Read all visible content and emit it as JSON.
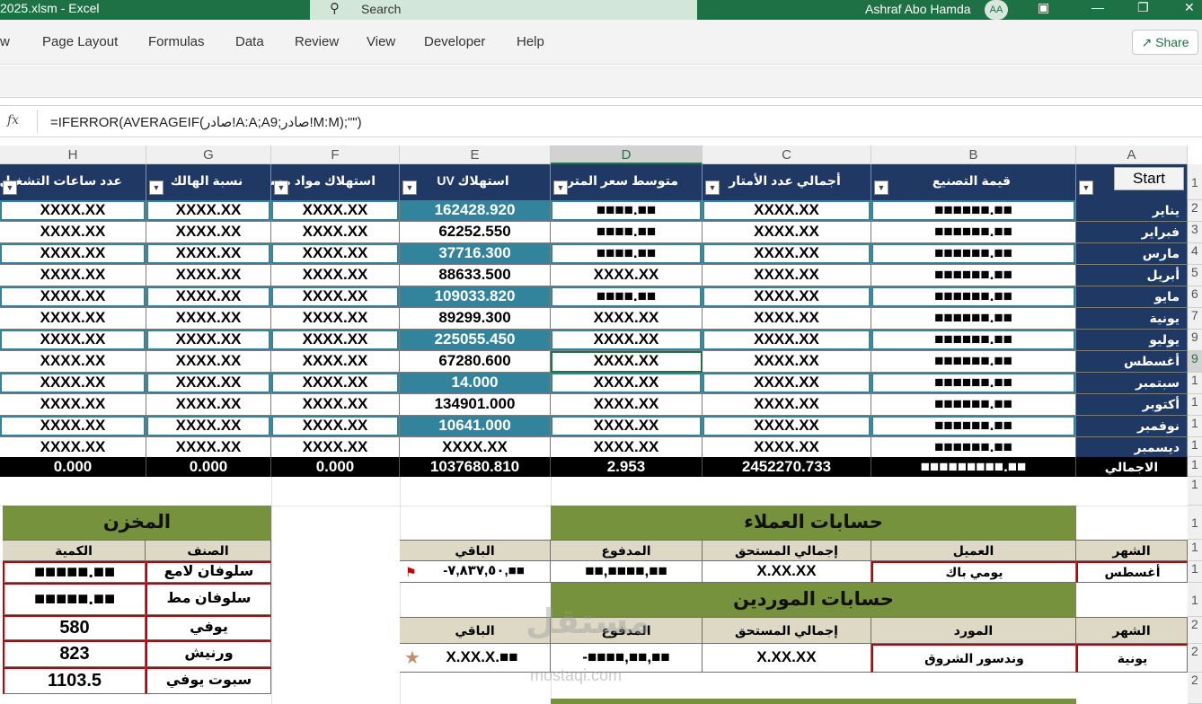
{
  "titlebar": {
    "file_title": "2025.xlsm  -  Excel",
    "search_placeholder": "Search",
    "user_name": "Ashraf Abo Hamda",
    "user_initials": "AA"
  },
  "menu": {
    "items": [
      "w",
      "Page Layout",
      "Formulas",
      "Data",
      "Review",
      "View",
      "Developer",
      "Help"
    ],
    "share_label": "Share"
  },
  "formula_bar": {
    "fx_label": "fx",
    "formula": "=IFERROR(AVERAGEIF(صادر!A:A;A9;صادر!M:M);\"\")"
  },
  "columns": [
    "H",
    "G",
    "F",
    "E",
    "D",
    "C",
    "B",
    "A"
  ],
  "row_numbers": [
    "1",
    "2",
    "3",
    "4",
    "5",
    "6",
    "7",
    "9",
    "9",
    "1",
    "1",
    "1",
    "1",
    "1",
    "1",
    "1",
    "1",
    "1",
    "1",
    "2",
    "2",
    "2"
  ],
  "main_table": {
    "headers": {
      "H": "عدد ساعات التشغيل",
      "G": "نسبة الهالك",
      "F": "استهلاك مواد مساعدة",
      "E": "استهلاك UV",
      "D": "متوسط سعر المتر",
      "C": "أجمالي عدد الأمتار",
      "B": "قيمة التصنيع"
    },
    "start_button": "Start",
    "rows": [
      {
        "month": "يناير",
        "B": "■■■■■■.■■",
        "C": "XXXX.XX",
        "D": "■■■■.■■",
        "E": "162428.920",
        "F": "XXXX.XX",
        "G": "XXXX.XX",
        "H": "XXXX.XX"
      },
      {
        "month": "فبراير",
        "B": "■■■■■■.■■",
        "C": "XXXX.XX",
        "D": "■■■■.■■",
        "E": "62252.550",
        "F": "XXXX.XX",
        "G": "XXXX.XX",
        "H": "XXXX.XX"
      },
      {
        "month": "مارس",
        "B": "■■■■■■.■■",
        "C": "XXXX.XX",
        "D": "■■■■.■■",
        "E": "37716.300",
        "F": "XXXX.XX",
        "G": "XXXX.XX",
        "H": "XXXX.XX"
      },
      {
        "month": "أبريل",
        "B": "■■■■■■.■■",
        "C": "XXXX.XX",
        "D": "XXXX.XX",
        "E": "88633.500",
        "F": "XXXX.XX",
        "G": "XXXX.XX",
        "H": "XXXX.XX"
      },
      {
        "month": "مايو",
        "B": "■■■■■■.■■",
        "C": "XXXX.XX",
        "D": "■■■■.■■",
        "E": "109033.820",
        "F": "XXXX.XX",
        "G": "XXXX.XX",
        "H": "XXXX.XX"
      },
      {
        "month": "يونية",
        "B": "■■■■■■.■■",
        "C": "XXXX.XX",
        "D": "XXXX.XX",
        "E": "89299.300",
        "F": "XXXX.XX",
        "G": "XXXX.XX",
        "H": "XXXX.XX"
      },
      {
        "month": "يوليو",
        "B": "■■■■■■.■■",
        "C": "XXXX.XX",
        "D": "XXXX.XX",
        "E": "225055.450",
        "F": "XXXX.XX",
        "G": "XXXX.XX",
        "H": "XXXX.XX"
      },
      {
        "month": "أغسطس",
        "B": "■■■■■■.■■",
        "C": "XXXX.XX",
        "D": "XXXX.XX",
        "E": "67280.600",
        "F": "XXXX.XX",
        "G": "XXXX.XX",
        "H": "XXXX.XX"
      },
      {
        "month": "سبتمبر",
        "B": "■■■■■■.■■",
        "C": "XXXX.XX",
        "D": "XXXX.XX",
        "E": "14.000",
        "F": "XXXX.XX",
        "G": "XXXX.XX",
        "H": "XXXX.XX"
      },
      {
        "month": "أكتوبر",
        "B": "■■■■■■.■■",
        "C": "XXXX.XX",
        "D": "XXXX.XX",
        "E": "134901.000",
        "F": "XXXX.XX",
        "G": "XXXX.XX",
        "H": "XXXX.XX"
      },
      {
        "month": "نوفمبر",
        "B": "■■■■■■.■■",
        "C": "XXXX.XX",
        "D": "XXXX.XX",
        "E": "10641.000",
        "F": "XXXX.XX",
        "G": "XXXX.XX",
        "H": "XXXX.XX"
      },
      {
        "month": "ديسمبر",
        "B": "■■■■■■.■■",
        "C": "XXXX.XX",
        "D": "XXXX.XX",
        "E": "XXXX.XX",
        "F": "XXXX.XX",
        "G": "XXXX.XX",
        "H": "XXXX.XX"
      }
    ],
    "total": {
      "label": "الاجمالي",
      "B": "■■■■■■■■■.■■",
      "C": "2452270.733",
      "D": "2.953",
      "E": "1037680.810",
      "F": "0.000",
      "G": "0.000",
      "H": "0.000"
    }
  },
  "store": {
    "title": "المخزن",
    "col_item": "الصنف",
    "col_qty": "الكمية",
    "rows": [
      {
        "item": "سلوفان لامع",
        "qty": "■■■■■.■■"
      },
      {
        "item": "سلوفان مط",
        "qty": "■■■■■.■■"
      },
      {
        "item": "يوفي",
        "qty": "580"
      },
      {
        "item": "ورنيش",
        "qty": "823"
      },
      {
        "item": "سبوت يوفي",
        "qty": "1103.5"
      }
    ]
  },
  "customers": {
    "title": "حسابات العملاء",
    "headers": [
      "الشهر",
      "العميل",
      "إجمالي المستحق",
      "المدفوع",
      "الباقي"
    ],
    "row": {
      "month": "أغسطس",
      "name": "يومي باك",
      "due": "X.XX.XX",
      "paid": "■■,■■■■,■■",
      "remaining": "-٧,٨٣٧,٥٠,■■"
    }
  },
  "suppliers": {
    "title": "حسابات الموردين",
    "headers": [
      "الشهر",
      "المورد",
      "إجمالي المستحق",
      "المدفوع",
      "الباقي"
    ],
    "row": {
      "month": "يونية",
      "name": "وندسور الشروق",
      "due": "X.XX.XX",
      "paid": "-■■■■,■■,■■",
      "remaining": "X.XX.X.■■"
    }
  },
  "watermark": {
    "arabic": "مستقل",
    "latin": "mostaqi.com"
  },
  "colors": {
    "excel_green": "#1e7145",
    "navy": "#1f3864",
    "teal": "#31849b",
    "olive": "#76923c",
    "beige": "#ddd9c4",
    "red_border": "#c00000"
  }
}
